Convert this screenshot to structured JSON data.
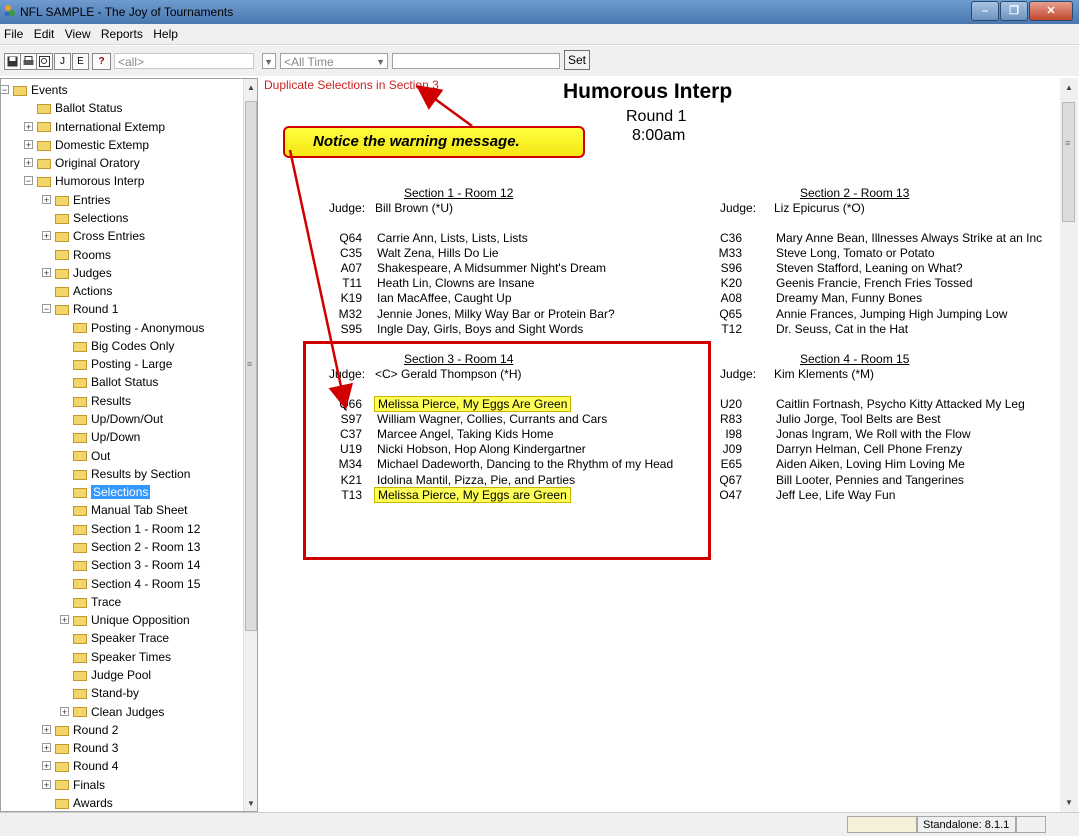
{
  "window": {
    "title": "NFL SAMPLE - The Joy of Tournaments",
    "minimize": "–",
    "restore": "❐",
    "close": "✕"
  },
  "menu": [
    "File",
    "Edit",
    "View",
    "Reports",
    "Help"
  ],
  "toolbar": {
    "buttons": [
      "J",
      "E"
    ],
    "help": "?",
    "filter_combo": "<all>",
    "time_combo": "<All Time",
    "set_label": "Set"
  },
  "tree": {
    "items": [
      {
        "label": "Events",
        "level": 0,
        "exp": "⊟"
      },
      {
        "label": "Ballot Status",
        "level": 1
      },
      {
        "label": "International Extemp",
        "level": 1,
        "exp": "⊞"
      },
      {
        "label": "Domestic Extemp",
        "level": 1,
        "exp": "⊞"
      },
      {
        "label": "Original Oratory",
        "level": 1,
        "exp": "⊞"
      },
      {
        "label": "Humorous Interp",
        "level": 1,
        "exp": "⊟"
      },
      {
        "label": "Entries",
        "level": 2,
        "exp": "⊞"
      },
      {
        "label": "Selections",
        "level": 2
      },
      {
        "label": "Cross Entries",
        "level": 2,
        "exp": "⊞"
      },
      {
        "label": "Rooms",
        "level": 2
      },
      {
        "label": "Judges",
        "level": 2,
        "exp": "⊞"
      },
      {
        "label": "Actions",
        "level": 2
      },
      {
        "label": "Round 1",
        "level": 2,
        "exp": "⊟"
      },
      {
        "label": "Posting - Anonymous",
        "level": 3
      },
      {
        "label": "Big Codes Only",
        "level": 3
      },
      {
        "label": "Posting - Large",
        "level": 3
      },
      {
        "label": "Ballot Status",
        "level": 3
      },
      {
        "label": "Results",
        "level": 3
      },
      {
        "label": "Up/Down/Out",
        "level": 3
      },
      {
        "label": "Up/Down",
        "level": 3
      },
      {
        "label": "Out",
        "level": 3
      },
      {
        "label": "Results by Section",
        "level": 3
      },
      {
        "label": "Selections",
        "level": 3,
        "selected": true
      },
      {
        "label": "Manual Tab Sheet",
        "level": 3
      },
      {
        "label": "Section 1 - Room 12",
        "level": 3
      },
      {
        "label": "Section 2 - Room 13",
        "level": 3
      },
      {
        "label": "Section 3 - Room 14",
        "level": 3
      },
      {
        "label": "Section 4 - Room 15",
        "level": 3
      },
      {
        "label": "Trace",
        "level": 3
      },
      {
        "label": "Unique Opposition",
        "level": 3,
        "exp": "⊞"
      },
      {
        "label": "Speaker Trace",
        "level": 3
      },
      {
        "label": "Speaker Times",
        "level": 3
      },
      {
        "label": "Judge Pool",
        "level": 3
      },
      {
        "label": "Stand-by",
        "level": 3
      },
      {
        "label": "Clean Judges",
        "level": 3,
        "exp": "⊞"
      },
      {
        "label": "Round 2",
        "level": 2,
        "exp": "⊞"
      },
      {
        "label": "Round 3",
        "level": 2,
        "exp": "⊞"
      },
      {
        "label": "Round 4",
        "level": 2,
        "exp": "⊞"
      },
      {
        "label": "Finals",
        "level": 2,
        "exp": "⊞"
      },
      {
        "label": "Awards",
        "level": 2
      }
    ]
  },
  "report": {
    "warning": "Duplicate Selections in Section 3",
    "title": "Humorous Interp",
    "round": "Round 1",
    "time": "8:00am",
    "judge_label": "Judge:",
    "sections": [
      {
        "heading": "Section 1 - Room 12",
        "judge": "Bill Brown (*U)",
        "entries": [
          {
            "code": "Q64",
            "text": "Carrie Ann, Lists, Lists, Lists"
          },
          {
            "code": "C35",
            "text": "Walt Zena, Hills Do Lie"
          },
          {
            "code": "A07",
            "text": "Shakespeare, A Midsummer Night's Dream"
          },
          {
            "code": "T11",
            "text": "Heath Lin, Clowns are Insane"
          },
          {
            "code": "K19",
            "text": "Ian MacAffee, Caught Up"
          },
          {
            "code": "M32",
            "text": "Jennie Jones, Milky Way Bar or Protein Bar?"
          },
          {
            "code": "S95",
            "text": "Ingle Day, Girls, Boys and Sight Words"
          }
        ]
      },
      {
        "heading": "Section 2 - Room 13",
        "judge": "Liz Epicurus (*O)",
        "entries": [
          {
            "code": "C36",
            "text": "Mary Anne Bean, Illnesses Always Strike at an Inc"
          },
          {
            "code": "M33",
            "text": "Steve Long, Tomato or Potato"
          },
          {
            "code": "S96",
            "text": "Steven Stafford, Leaning on What?"
          },
          {
            "code": "K20",
            "text": "Geenis Francie, French Fries Tossed"
          },
          {
            "code": "A08",
            "text": "Dreamy Man, Funny Bones"
          },
          {
            "code": "Q65",
            "text": "Annie Frances, Jumping High Jumping Low"
          },
          {
            "code": "T12",
            "text": "Dr. Seuss, Cat in the Hat"
          }
        ]
      },
      {
        "heading": "Section 3 - Room 14",
        "judge": "<C> Gerald Thompson (*H)",
        "entries": [
          {
            "code": "Q66",
            "text": "Melissa Pierce, My Eggs Are Green",
            "highlight": true
          },
          {
            "code": "S97",
            "text": "William Wagner, Collies, Currants and Cars"
          },
          {
            "code": "C37",
            "text": "Marcee Angel, Taking Kids Home"
          },
          {
            "code": "U19",
            "text": "Nicki Hobson, Hop Along Kindergartner"
          },
          {
            "code": "M34",
            "text": "Michael Dadeworth, Dancing to the Rhythm of my Head"
          },
          {
            "code": "K21",
            "text": "Idolina Mantil, Pizza, Pie, and Parties"
          },
          {
            "code": "T13",
            "text": "Melissa Pierce, My Eggs are Green",
            "highlight": true
          }
        ]
      },
      {
        "heading": "Section 4 - Room 15",
        "judge": "Kim Klements (*M)",
        "entries": [
          {
            "code": "U20",
            "text": "Caitlin Fortnash, Psycho Kitty Attacked My Leg"
          },
          {
            "code": "R83",
            "text": "Julio Jorge, Tool Belts are Best"
          },
          {
            "code": "I98",
            "text": "Jonas Ingram, We Roll with the Flow"
          },
          {
            "code": "J09",
            "text": "Darryn Helman, Cell Phone Frenzy"
          },
          {
            "code": "E65",
            "text": "Aiden Aiken, Loving Him Loving Me"
          },
          {
            "code": "Q67",
            "text": "Bill Looter, Pennies and Tangerines"
          },
          {
            "code": "O47",
            "text": "Jeff Lee, Life Way Fun"
          }
        ]
      }
    ]
  },
  "annotation": {
    "callout": "Notice the warning message."
  },
  "status": {
    "version": "Standalone: 8.1.1"
  },
  "colors": {
    "warning": "#cc2222",
    "annotation_red": "#d10000",
    "highlight": "#ffff55",
    "selection": "#3399ff"
  }
}
